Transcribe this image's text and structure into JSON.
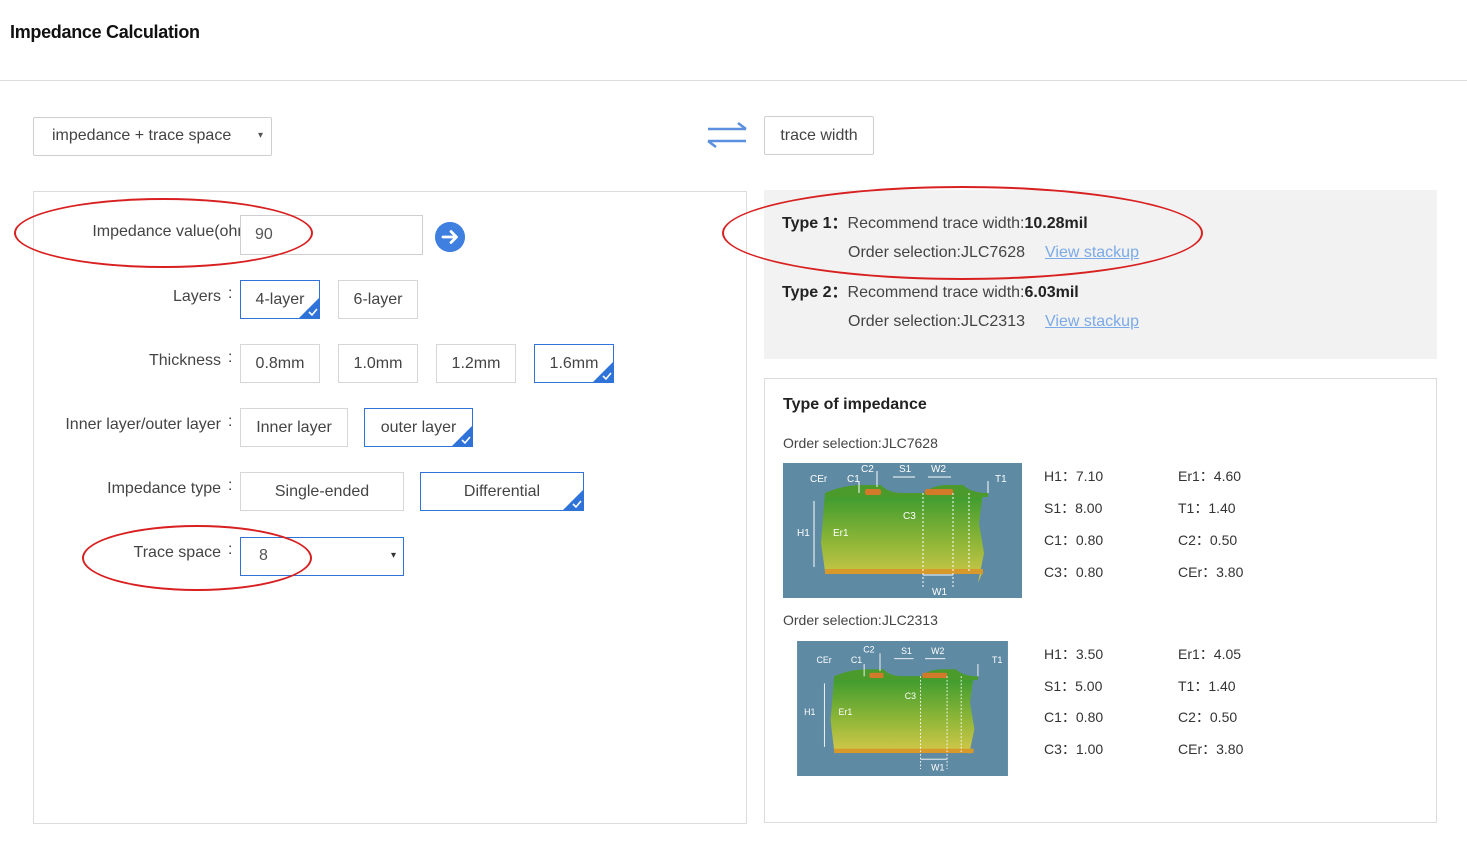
{
  "header": {
    "title": "Impedance Calculation"
  },
  "toolbar": {
    "mode_select": "impedance + trace space",
    "mode_caret": "▾",
    "swap_icon": "swap-arrows-icon",
    "trace_width_button": "trace width"
  },
  "form": {
    "colon": ":",
    "impedance": {
      "label": "Impedance value(ohm)",
      "value": "90"
    },
    "layers": {
      "label": "Layers",
      "options": [
        "4-layer",
        "6-layer"
      ],
      "selected": "4-layer"
    },
    "thickness": {
      "label": "Thickness",
      "options": [
        "0.8mm",
        "1.0mm",
        "1.2mm",
        "1.6mm"
      ],
      "selected": "1.6mm"
    },
    "inner_outer": {
      "label": "Inner layer/outer layer",
      "options": [
        "Inner layer",
        "outer layer"
      ],
      "selected": "outer layer"
    },
    "impedance_type": {
      "label": "Impedance type",
      "options": [
        "Single-ended",
        "Differential"
      ],
      "selected": "Differential"
    },
    "trace_space": {
      "label": "Trace space",
      "value": "8",
      "caret": "▾"
    }
  },
  "results": [
    {
      "type_label": "Type 1：",
      "recommend_label": "Recommend trace width:",
      "width": "10.28mil",
      "order_label": "Order selection:JLC7628",
      "link": "View stackup"
    },
    {
      "type_label": "Type 2：",
      "recommend_label": "Recommend trace width:",
      "width": "6.03mil",
      "order_label": "Order selection:JLC2313",
      "link": "View stackup"
    }
  ],
  "impedance_types": {
    "title": "Type of impedance",
    "stackups": [
      {
        "order_label": "Order selection:JLC7628",
        "diagram_labels": {
          "cer": "CEr",
          "c1": "C1",
          "c2": "C2",
          "s1": "S1",
          "w2": "W2",
          "t1": "T1",
          "c3": "C3",
          "h1": "H1",
          "er1": "Er1",
          "w1": "W1"
        },
        "params": [
          "H1：7.10",
          "Er1：4.60",
          "S1：8.00",
          "T1：1.40",
          "C1：0.80",
          "C2：0.50",
          "C3：0.80",
          "CEr：3.80"
        ]
      },
      {
        "order_label": "Order selection:JLC2313",
        "diagram_labels": {
          "cer": "CEr",
          "c1": "C1",
          "c2": "C2",
          "s1": "S1",
          "w2": "W2",
          "t1": "T1",
          "c3": "C3",
          "h1": "H1",
          "er1": "Er1",
          "w1": "W1"
        },
        "params": [
          "H1：3.50",
          "Er1：4.05",
          "S1：5.00",
          "T1：1.40",
          "C1：0.80",
          "C2：0.50",
          "C3：1.00",
          "CEr：3.80"
        ]
      }
    ]
  },
  "colors": {
    "accent": "#2f72d8",
    "annotation": "#d82020",
    "link": "#7aaae8"
  }
}
